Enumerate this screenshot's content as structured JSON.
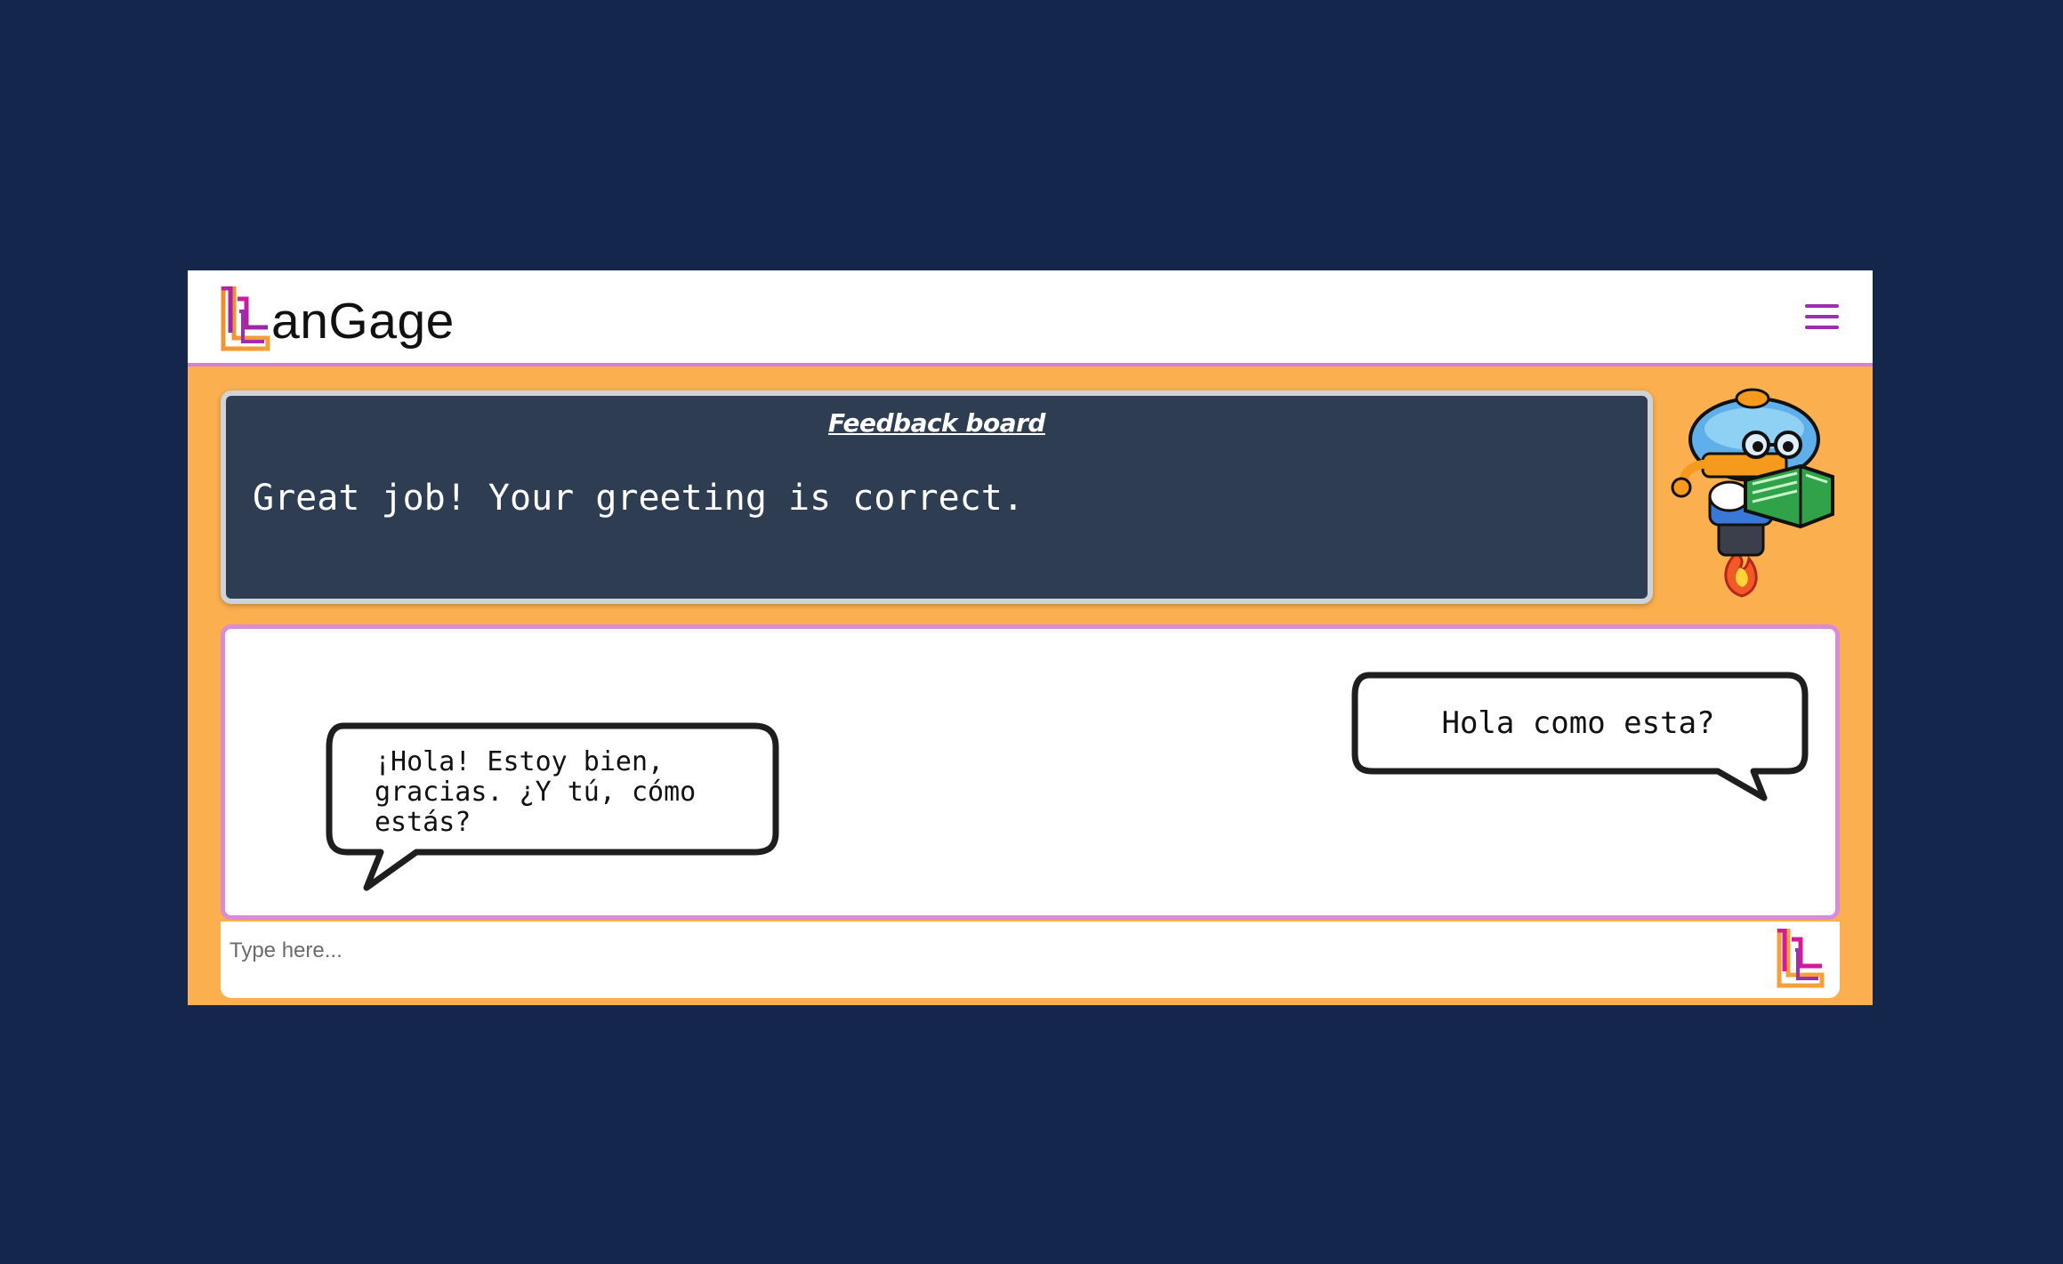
{
  "app": {
    "brand": "anGage",
    "logo_icon": "langage-l-logo-icon",
    "menu_icon": "hamburger-menu-icon"
  },
  "colors": {
    "page_background": "#15264d",
    "app_background": "#fbaf4f",
    "navbar_border": "#d77fd6",
    "feedback_background": "#2e3d52",
    "accent_purple": "#9b2fae"
  },
  "feedback": {
    "title": "Feedback board",
    "message": "Great job! Your greeting is correct."
  },
  "mascot": {
    "icon": "robot-reading-book-mascot"
  },
  "chat": {
    "messages": [
      {
        "side": "left",
        "text": "¡Hola! Estoy bien,\ngracias. ¿Y tú, cómo\nestás?"
      },
      {
        "side": "right",
        "text": "Hola como esta?"
      }
    ]
  },
  "input": {
    "placeholder": "Type here...",
    "value": "",
    "send_icon": "send-logo-icon"
  }
}
